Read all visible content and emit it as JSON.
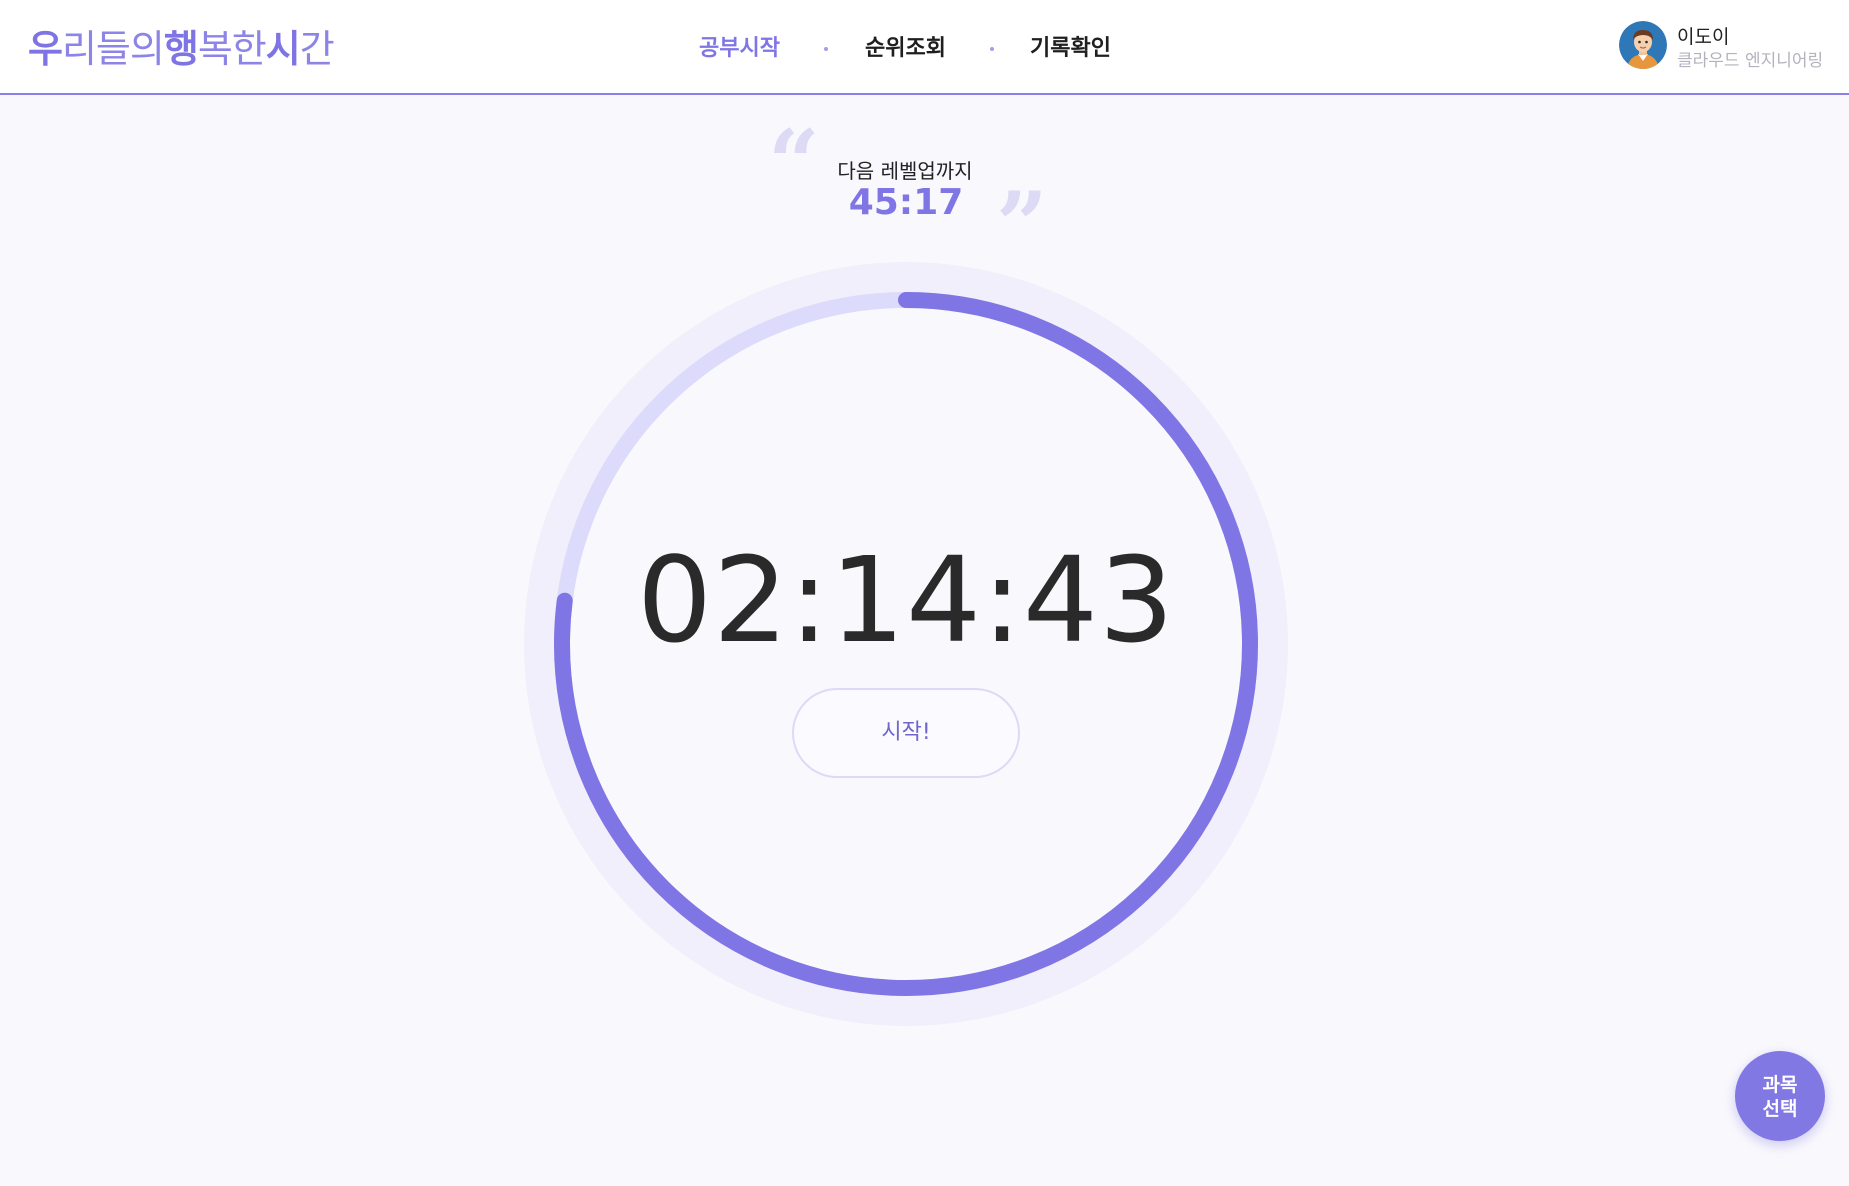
{
  "header": {
    "logo_parts": [
      {
        "text": "우",
        "strong": true
      },
      {
        "text": "리들의",
        "strong": false
      },
      {
        "text": "행",
        "strong": true
      },
      {
        "text": "복한",
        "strong": false
      },
      {
        "text": "시",
        "strong": true
      },
      {
        "text": "간",
        "strong": false
      }
    ],
    "nav": [
      {
        "label": "공부시작",
        "active": true
      },
      {
        "label": "순위조회",
        "active": false
      },
      {
        "label": "기록확인",
        "active": false
      }
    ],
    "profile": {
      "name": "이도이",
      "role": "클라우드 엔지니어링"
    }
  },
  "main": {
    "next_level_label": "다음 레벨업까지",
    "next_level_time": "45:17",
    "timer": "02:14:43",
    "progress_fraction": 0.77,
    "start_label": "시작!",
    "subject_button": {
      "line1": "과목",
      "line2": "선택"
    }
  },
  "colors": {
    "accent": "#8075e4",
    "track": "#dcdbfb",
    "outer_ring": "#f0effb",
    "background": "#f9f9fd"
  }
}
